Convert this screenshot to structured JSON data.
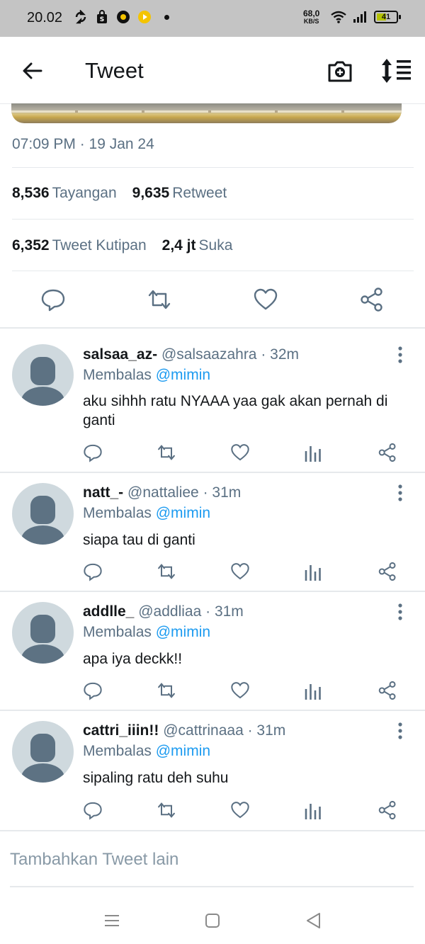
{
  "status_bar": {
    "time": "20.02",
    "speed_value": "68,0",
    "speed_unit": "KB/S",
    "battery": "41"
  },
  "header": {
    "title": "Tweet"
  },
  "tweet": {
    "timestamp": "07:09 PM · 19 Jan 24",
    "stats": {
      "views_count": "8,536",
      "views_label": "Tayangan",
      "retweets_count": "9,635",
      "retweets_label": "Retweet",
      "quotes_count": "6,352",
      "quotes_label": "Tweet Kutipan",
      "likes_count": "2,4 jt",
      "likes_label": "Suka"
    }
  },
  "replies": [
    {
      "name": "salsaa_az-",
      "handle": "@salsaazahra",
      "time": "32m",
      "replying_label": "Membalas",
      "replying_to": "@mimin",
      "text": "aku sihhh ratu NYAAA yaa gak akan pernah di ganti"
    },
    {
      "name": "natt_-",
      "handle": "@nattaliee",
      "time": "31m",
      "replying_label": "Membalas",
      "replying_to": "@mimin",
      "text": "siapa tau di ganti"
    },
    {
      "name": "addlle_",
      "handle": "@addliaa",
      "time": "31m",
      "replying_label": "Membalas",
      "replying_to": "@mimin",
      "text": "apa iya deckk!!"
    },
    {
      "name": "cattri_iiin!!",
      "handle": "@cattrinaaa",
      "time": "31m",
      "replying_label": "Membalas",
      "replying_to": "@mimin",
      "text": "sipaling ratu deh suhu"
    }
  ],
  "compose": {
    "placeholder": "Tambahkan Tweet lain"
  },
  "colors": {
    "accent": "#1d9bf0",
    "muted": "#5b7083",
    "text": "#14171a",
    "divider": "#e6e9ec"
  }
}
